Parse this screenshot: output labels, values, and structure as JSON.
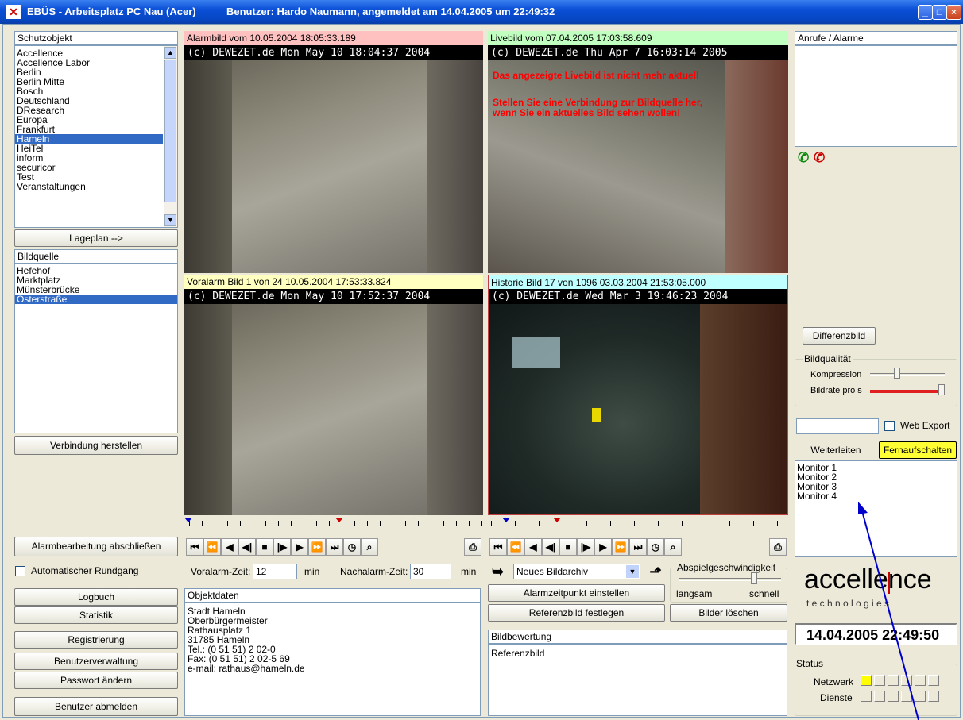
{
  "window": {
    "title": "EBÜS - Arbeitsplatz PC Nau (Acer)",
    "user_info": "Benutzer: Hardo Naumann, angemeldet am 14.04.2005 um 22:49:32",
    "minimize": "_",
    "maximize": "□",
    "close": "×"
  },
  "left": {
    "schutzobjekt_header": "Schutzobjekt",
    "schutzobjekte": [
      "Accellence",
      "Accellence Labor",
      "Berlin",
      "Berlin Mitte",
      "Bosch",
      "Deutschland",
      "DResearch",
      "Europa",
      "Frankfurt",
      "Hameln",
      "HeiTel",
      "inform",
      "securicor",
      "Test",
      "Veranstaltungen"
    ],
    "selected_schutzobjekt": "Hameln",
    "lageplan_button": "Lageplan -->",
    "bildquelle_header": "Bildquelle",
    "bildquellen": [
      "Hefehof",
      "Marktplatz",
      "Münsterbrücke",
      "Osterstraße"
    ],
    "selected_bildquelle": "Osterstraße",
    "verbindung_button": "Verbindung herstellen",
    "alarm_abschliessen_button": "Alarmbearbeitung abschließen",
    "auto_rundgang_label": "Automatischer Rundgang",
    "logbuch_button": "Logbuch",
    "statistik_button": "Statistik",
    "registrierung_button": "Registrierung",
    "benutzerverwaltung_button": "Benutzerverwaltung",
    "passwort_button": "Passwort ändern",
    "abmelden_button": "Benutzer abmelden"
  },
  "cameras": {
    "alarm": {
      "title": "Alarmbild vom 10.05.2004 18:05:33.189",
      "stamp": "(c) DEWEZET.de  Mon May 10  18:04:37  2004"
    },
    "live": {
      "title": "Livebild vom 07.04.2005 17:03:58.609",
      "stamp": "(c) DEWEZET.de  Thu Apr  7  16:03:14  2005",
      "warning1": "Das angezeigte Livebild ist nicht mehr aktuell",
      "warning2": "Stellen Sie eine Verbindung zur Bildquelle her,",
      "warning3": "wenn Sie ein aktuelles Bild sehen wollen!"
    },
    "voralarm": {
      "title": "Voralarm Bild 1 von 24    10.05.2004 17:53:33.824",
      "stamp": "(c) DEWEZET.de  Mon May 10  17:52:37  2004"
    },
    "historie": {
      "title": "Historie Bild 17 von 1096    03.03.2004 21:53:05.000",
      "stamp": "(c) DEWEZET.de  Wed Mar  3  19:46:23  2004"
    }
  },
  "controls": {
    "icons": [
      "first-icon",
      "fast-rewind-icon",
      "step-back-icon",
      "prev-frame-icon",
      "stop-icon",
      "next-frame-icon",
      "play-icon",
      "fast-forward-icon",
      "last-icon",
      "clock-icon",
      "binoculars-icon"
    ],
    "glyphs": [
      "⏮",
      "⏪",
      "◀",
      "◀|",
      "■",
      "|▶",
      "▶",
      "⏩",
      "⏭",
      "◷",
      "⌕"
    ],
    "print_glyph": "⎙"
  },
  "alarm_params": {
    "voralarm_label": "Voralarm-Zeit:",
    "voralarm_value": "12",
    "voralarm_unit": "min",
    "nachalarm_label": "Nachalarm-Zeit:",
    "nachalarm_value": "30",
    "nachalarm_unit": "min"
  },
  "objektdaten": {
    "header": "Objektdaten",
    "lines": [
      "Stadt Hameln",
      "Oberbürgermeister",
      "Rathausplatz 1",
      "31785 Hameln",
      "Tel.: (0 51 51) 2 02-0",
      "Fax: (0 51 51) 2 02-5 69",
      "e-mail: rathaus@hameln.de"
    ]
  },
  "archive": {
    "select_value": "Neues Bildarchiv",
    "alarmzeitpunkt_button": "Alarmzeitpunkt einstellen",
    "referenzbild_button": "Referenzbild festlegen",
    "speed_group": "Abspielgeschwindigkeit",
    "speed_slow": "langsam",
    "speed_fast": "schnell",
    "speed_level": 0.75,
    "bilder_loeschen_button": "Bilder löschen",
    "bildbewertung_header": "Bildbewertung",
    "bildbewertung_value": "Referenzbild"
  },
  "right": {
    "anrufe_header": "Anrufe / Alarme",
    "differenzbild_button": "Differenzbild",
    "bildqualitaet_group": "Bildqualität",
    "kompression_label": "Kompression",
    "kompression_level": 0.35,
    "bildrate_label": "Bildrate pro s",
    "bildrate_level": 1.0,
    "web_export_label": "Web Export",
    "weiterleiten_button": "Weiterleiten",
    "fernaufschalten_button": "Fernaufschalten",
    "monitors": [
      "Monitor 1",
      "Monitor 2",
      "Monitor 3",
      "Monitor 4"
    ],
    "logo_top": "accellence",
    "logo_bottom": "t e c h n o l o g i e s",
    "datetime": "14.04.2005 22:49:50",
    "status_group": "Status",
    "netzwerk_label": "Netzwerk",
    "dienste_label": "Dienste"
  },
  "colors": {
    "alarm_header": "#ffc0c0",
    "live_header": "#c0ffc0",
    "voralarm_header": "#ffffc0",
    "historie_header": "#c0ffff",
    "selection": "#316ac5",
    "warning_text": "#ff0000",
    "status_active": "#ffff00",
    "annotation_arrow": "#0000cc"
  }
}
